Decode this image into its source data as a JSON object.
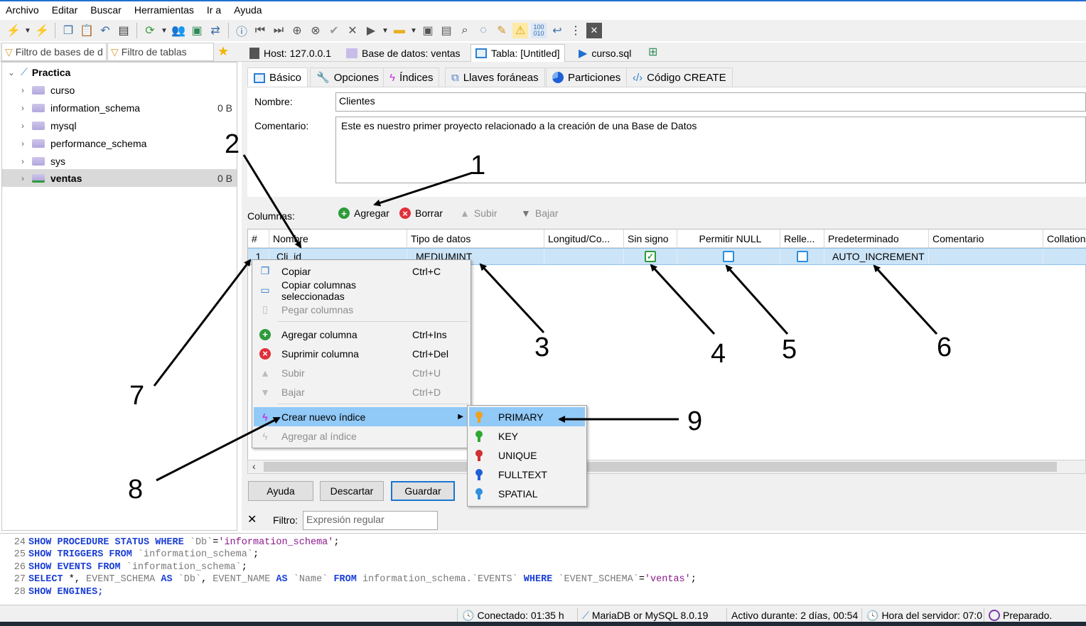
{
  "menubar": [
    "Archivo",
    "Editar",
    "Buscar",
    "Herramientas",
    "Ir a",
    "Ayuda"
  ],
  "filters": {
    "db_placeholder": "Filtro de bases de d",
    "table_placeholder": "Filtro de tablas"
  },
  "top_tabs": {
    "host": "Host: 127.0.0.1",
    "database": "Base de datos: ventas",
    "table": "Tabla: [Untitled]",
    "query": "curso.sql"
  },
  "tree": {
    "root": "Practica",
    "items": [
      {
        "name": "curso",
        "size": ""
      },
      {
        "name": "information_schema",
        "size": "0 B"
      },
      {
        "name": "mysql",
        "size": ""
      },
      {
        "name": "performance_schema",
        "size": ""
      },
      {
        "name": "sys",
        "size": ""
      },
      {
        "name": "ventas",
        "size": "0 B"
      }
    ]
  },
  "subtabs": [
    "Básico",
    "Opciones",
    "Índices",
    "Llaves foráneas",
    "Particiones",
    "Código CREATE"
  ],
  "form": {
    "name_label": "Nombre:",
    "name_value": "Clientes",
    "comment_label": "Comentario:",
    "comment_value": "Este es nuestro primer proyecto relacionado a la creación de una Base de Datos"
  },
  "columns_bar": {
    "label": "Columnas:",
    "add": "Agregar",
    "delete": "Borrar",
    "up": "Subir",
    "down": "Bajar"
  },
  "grid": {
    "headers": [
      "#",
      "Nombre",
      "Tipo de datos",
      "Longitud/Co...",
      "Sin signo",
      "Permitir NULL",
      "Relle...",
      "Predeterminado",
      "Comentario",
      "Collation"
    ],
    "row": {
      "num": "1",
      "name": "Cli_id",
      "type": "MEDIUMINT",
      "unsigned": true,
      "allow_null": false,
      "zerofill": false,
      "default": "AUTO_INCREMENT"
    }
  },
  "buttons": {
    "help": "Ayuda",
    "discard": "Descartar",
    "save": "Guardar"
  },
  "filter_bar": {
    "label": "Filtro:",
    "placeholder": "Expresión regular"
  },
  "context_menu": [
    {
      "label": "Copiar",
      "shortcut": "Ctrl+C",
      "disabled": false,
      "icon": "copy-icon"
    },
    {
      "label": "Copiar columnas seleccionadas",
      "shortcut": "",
      "disabled": false,
      "icon": "copy-columns-icon"
    },
    {
      "label": "Pegar columnas",
      "shortcut": "",
      "disabled": true,
      "icon": "paste-icon"
    },
    {
      "label": "Agregar columna",
      "shortcut": "Ctrl+Ins",
      "disabled": false,
      "icon": "add-icon"
    },
    {
      "label": "Suprimir columna",
      "shortcut": "Ctrl+Del",
      "disabled": false,
      "icon": "delete-icon"
    },
    {
      "label": "Subir",
      "shortcut": "Ctrl+U",
      "disabled": true,
      "icon": "up-icon"
    },
    {
      "label": "Bajar",
      "shortcut": "Ctrl+D",
      "disabled": true,
      "icon": "down-icon"
    },
    {
      "label": "Crear nuevo índice",
      "shortcut": "",
      "disabled": false,
      "icon": "lightning-icon"
    },
    {
      "label": "Agregar al índice",
      "shortcut": "",
      "disabled": true,
      "icon": "lightning-gray-icon"
    }
  ],
  "index_submenu": [
    {
      "label": "PRIMARY",
      "color": "#f0a020"
    },
    {
      "label": "KEY",
      "color": "#2fa82f"
    },
    {
      "label": "UNIQUE",
      "color": "#d03030"
    },
    {
      "label": "FULLTEXT",
      "color": "#1f5fd8"
    },
    {
      "label": "SPATIAL",
      "color": "#2f8fe0"
    }
  ],
  "log": [
    {
      "n": "24",
      "parts": [
        [
          "kw",
          "SHOW PROCEDURE STATUS WHERE "
        ],
        [
          "idt",
          "`Db`"
        ],
        [
          "",
          "="
        ],
        [
          "str",
          "'information_schema'"
        ],
        [
          "",
          ";"
        ]
      ]
    },
    {
      "n": "25",
      "parts": [
        [
          "kw",
          "SHOW TRIGGERS FROM "
        ],
        [
          "idt",
          "`information_schema`"
        ],
        [
          "",
          ";"
        ]
      ]
    },
    {
      "n": "26",
      "parts": [
        [
          "kw",
          "SHOW EVENTS FROM "
        ],
        [
          "idt",
          "`information_schema`"
        ],
        [
          "",
          ";"
        ]
      ]
    },
    {
      "n": "27",
      "parts": [
        [
          "kw",
          "SELECT "
        ],
        [
          "",
          "*, "
        ],
        [
          "idt",
          "EVENT_SCHEMA "
        ],
        [
          "kw",
          "AS "
        ],
        [
          "idt",
          "`Db`"
        ],
        [
          "",
          ", "
        ],
        [
          "idt",
          "EVENT_NAME "
        ],
        [
          "kw",
          "AS "
        ],
        [
          "idt",
          "`Name` "
        ],
        [
          "kw",
          "FROM "
        ],
        [
          "idt",
          "information_schema.`EVENTS` "
        ],
        [
          "kw",
          "WHERE "
        ],
        [
          "idt",
          "`EVENT_SCHEMA`"
        ],
        [
          "",
          "="
        ],
        [
          "str",
          "'ventas'"
        ],
        [
          "",
          ";"
        ]
      ]
    },
    {
      "n": "28",
      "parts": [
        [
          "kw",
          "SHOW ENGINES;"
        ]
      ]
    }
  ],
  "status": {
    "connected": "Conectado: 01:35 h",
    "server": "MariaDB or MySQL 8.0.19",
    "uptime": "Activo durante: 2 días, 00:54",
    "server_time": "Hora del servidor: 07:0",
    "state": "Preparado."
  },
  "annotations": [
    "1",
    "2",
    "3",
    "4",
    "5",
    "6",
    "7",
    "8",
    "9"
  ]
}
